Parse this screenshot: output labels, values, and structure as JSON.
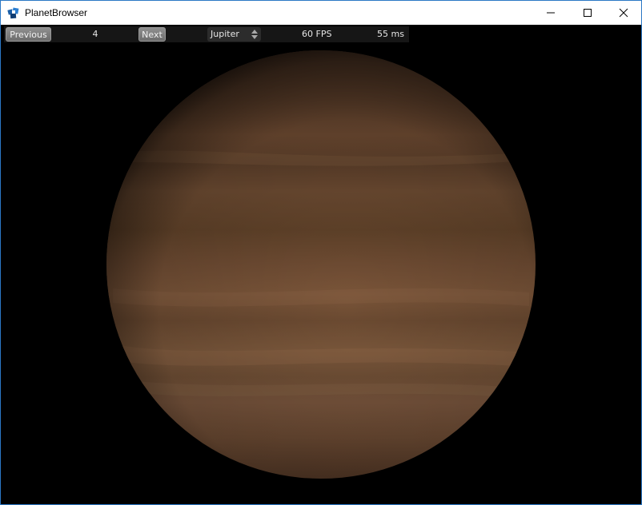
{
  "window": {
    "title": "PlanetBrowser",
    "icon": "planetbrowser-app-icon",
    "controls": [
      "minimize-icon",
      "maximize-icon",
      "close-icon"
    ]
  },
  "toolbar": {
    "previous_label": "Previous",
    "index": "4",
    "next_label": "Next",
    "planet_selected": "Jupiter",
    "fps": "60 FPS",
    "frame_time": "55 ms"
  },
  "scene": {
    "planet": "Jupiter",
    "background_color": "#000000",
    "planet_base_color": "#6e4a30"
  }
}
